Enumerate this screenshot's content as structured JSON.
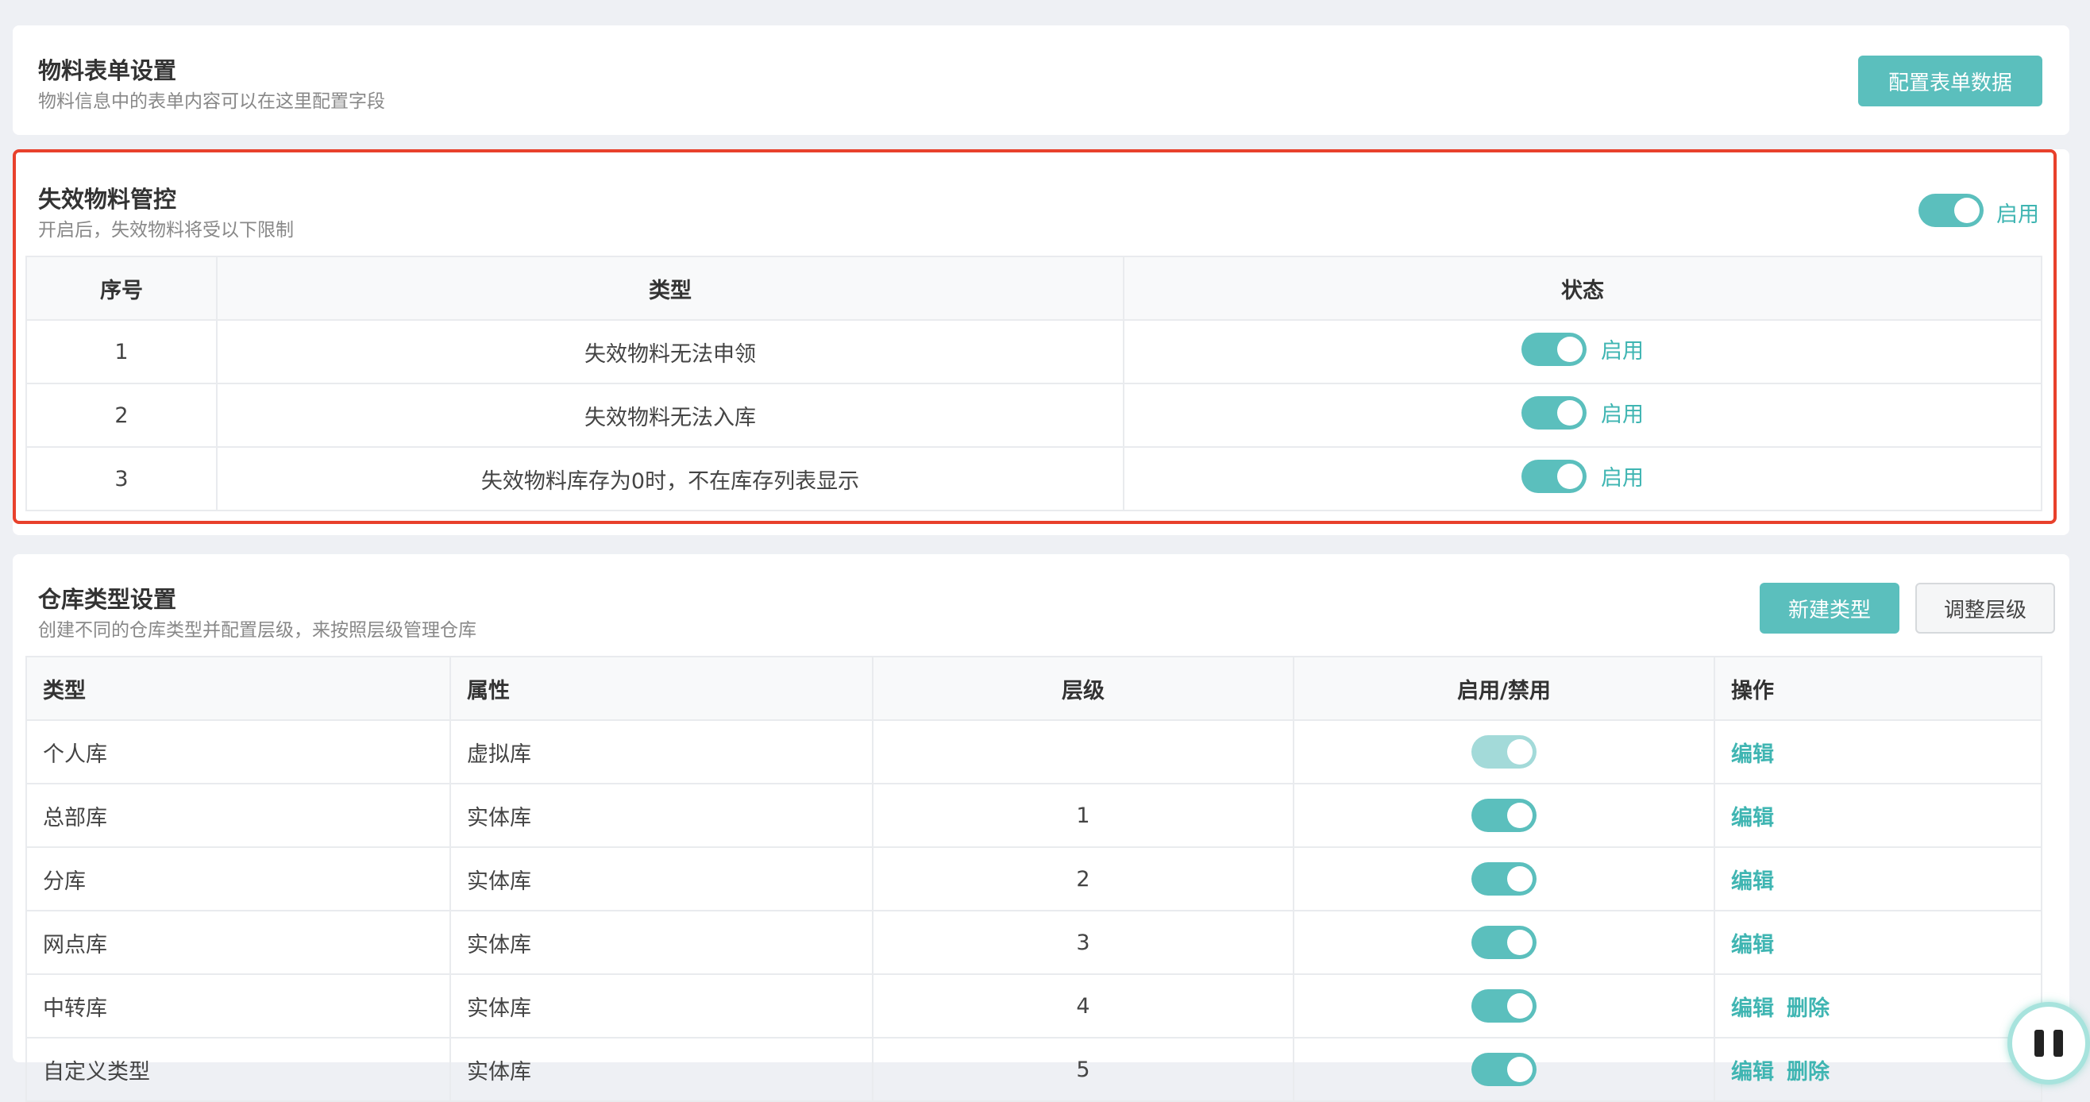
{
  "form_settings": {
    "title": "物料表单设置",
    "subtitle": "物料信息中的表单内容可以在这里配置字段",
    "config_button": "配置表单数据"
  },
  "invalid_material": {
    "title": "失效物料管控",
    "subtitle": "开启后，失效物料将受以下限制",
    "toggle_label": "启用",
    "enabled": true,
    "columns": [
      "序号",
      "类型",
      "状态"
    ],
    "rows": [
      {
        "index": "1",
        "type": "失效物料无法申领",
        "status": "启用"
      },
      {
        "index": "2",
        "type": "失效物料无法入库",
        "status": "启用"
      },
      {
        "index": "3",
        "type": "失效物料库存为0时，不在库存列表显示",
        "status": "启用"
      }
    ]
  },
  "warehouse_types": {
    "title": "仓库类型设置",
    "subtitle": "创建不同的仓库类型并配置层级，来按照层级管理仓库",
    "new_button": "新建类型",
    "adjust_button": "调整层级",
    "columns": [
      "类型",
      "属性",
      "层级",
      "启用/禁用",
      "操作"
    ],
    "rows": [
      {
        "type": "个人库",
        "attr": "虚拟库",
        "level": "",
        "enabled": true,
        "disabled_toggle": true,
        "actions": [
          "编辑"
        ]
      },
      {
        "type": "总部库",
        "attr": "实体库",
        "level": "1",
        "enabled": true,
        "disabled_toggle": false,
        "actions": [
          "编辑"
        ]
      },
      {
        "type": "分库",
        "attr": "实体库",
        "level": "2",
        "enabled": true,
        "disabled_toggle": false,
        "actions": [
          "编辑"
        ]
      },
      {
        "type": "网点库",
        "attr": "实体库",
        "level": "3",
        "enabled": true,
        "disabled_toggle": false,
        "actions": [
          "编辑"
        ]
      },
      {
        "type": "中转库",
        "attr": "实体库",
        "level": "4",
        "enabled": true,
        "disabled_toggle": false,
        "actions": [
          "编辑",
          "删除"
        ]
      },
      {
        "type": "自定义类型",
        "attr": "实体库",
        "level": "5",
        "enabled": true,
        "disabled_toggle": false,
        "actions": [
          "编辑",
          "删除"
        ]
      }
    ]
  },
  "colors": {
    "accent": "#5bbfbd",
    "highlight_border": "#e8412c"
  }
}
